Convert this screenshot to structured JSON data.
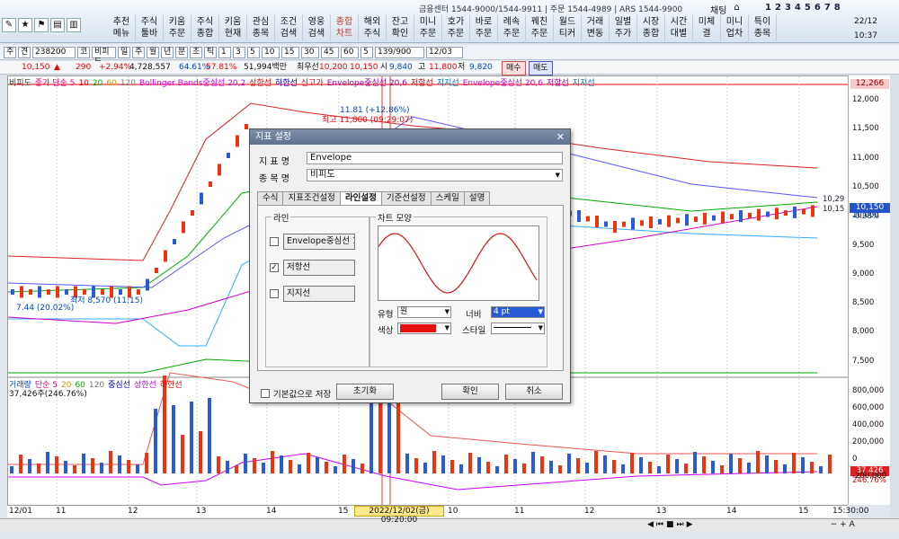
{
  "menubar": {
    "info": "금융센터 1544-9000/1544-9911 | 주문 1544-4989 | ARS 1544-9900",
    "chat": "채팅",
    "num_tabs": [
      "1",
      "2",
      "3",
      "4",
      "5",
      "6",
      "7",
      "8"
    ],
    "clock_date": "22/12",
    "clock_time": "10:37",
    "items": [
      {
        "l1": "추천",
        "l2": "메뉴"
      },
      {
        "l1": "주식",
        "l2": "툴바"
      },
      {
        "l1": "키움",
        "l2": "주문"
      },
      {
        "l1": "주식",
        "l2": "종합"
      },
      {
        "l1": "키움",
        "l2": "현재"
      },
      {
        "l1": "관심",
        "l2": "종목"
      },
      {
        "l1": "조건",
        "l2": "검색"
      },
      {
        "l1": "영웅",
        "l2": "검색"
      },
      {
        "l1": "종합",
        "l2": "차트"
      },
      {
        "l1": "해외",
        "l2": "주식"
      },
      {
        "l1": "잔고",
        "l2": "확인"
      },
      {
        "l1": "미니",
        "l2": "주문"
      },
      {
        "l1": "호가",
        "l2": "주문"
      },
      {
        "l1": "바로",
        "l2": "주문"
      },
      {
        "l1": "례속",
        "l2": "주문"
      },
      {
        "l1": "꿰친",
        "l2": "주문"
      },
      {
        "l1": "월드",
        "l2": "티커"
      },
      {
        "l1": "거래",
        "l2": "변동"
      },
      {
        "l1": "일별",
        "l2": "주가"
      },
      {
        "l1": "시장",
        "l2": "종합"
      },
      {
        "l1": "시간",
        "l2": "대별"
      },
      {
        "l1": "미체",
        "l2": "결"
      },
      {
        "l1": "미니",
        "l2": "업차"
      },
      {
        "l1": "특이",
        "l2": "종목"
      }
    ]
  },
  "toolbar1": {
    "items": [
      "주",
      "견",
      "238200",
      "코",
      "비피도",
      "일",
      "주",
      "월",
      "년",
      "분",
      "초",
      "틱",
      "1",
      "3",
      "5",
      "10",
      "15",
      "30",
      "45",
      "60",
      "5",
      "139/900",
      "12/03"
    ]
  },
  "toolbar2": {
    "price": "10,150",
    "change": "290",
    "pct": "+2.94%",
    "volume": "4,728,557",
    "v1": "64.61%",
    "v2": "57.81%",
    "amount": "51,994백만",
    "label_best": "최우선",
    "best1": "10,200",
    "best2": "10,150",
    "open_l": "시",
    "open": "9,840",
    "high_l": "고",
    "high": "11,800",
    "low_l": "저",
    "low": "9,820",
    "buy": "매수",
    "sell": "매도"
  },
  "legend_top": [
    "비피도",
    "종가 단순 5",
    "10",
    "20",
    "60",
    "120",
    "Bollinger Bands중심선 20,2",
    "상한선",
    "하한선",
    "신고가",
    "Envelope중심선 20,6",
    "저항선",
    "지지선",
    "Envelope중심선 20,6",
    "저항선",
    "지지선"
  ],
  "legend_bottom": [
    "거래량",
    "단순 5",
    "20",
    "60",
    "120",
    "중심선",
    "상한선",
    "하한선"
  ],
  "chart_labels": {
    "hi_note": "11.81 (+12.86%)",
    "hi_label": "최고 11,800 (09:29:07)",
    "lo_label": "최저 8,570 (11:15)",
    "pct_note": "7.44 (20.02%)",
    "vol_note": "37,426주(246.76%)",
    "tag1": "10,29",
    "tag2": "10,15",
    "tag3": "-0.98%",
    "cur_price": "10,150",
    "top_price": "12,266",
    "vol_tag": "37,426",
    "vol_pct": "246.76%"
  },
  "y_axis_labels": [
    "12,000",
    "11,500",
    "11,000",
    "10,500",
    "10,000",
    "9,500",
    "9,000",
    "8,500",
    "8,000",
    "7,500"
  ],
  "vol_axis_labels": [
    "800,000",
    "600,000",
    "400,000",
    "200,000",
    "0",
    "-200,000"
  ],
  "x_axis_labels": [
    "12/01",
    "11",
    "12",
    "13",
    "14",
    "15",
    "2022/12/02(금) 09:20:00",
    "10",
    "11",
    "12",
    "13",
    "14",
    "15",
    "15:30:00"
  ],
  "dialog": {
    "title": "지표 설정",
    "name_label": "지 표 명",
    "name_value": "Envelope",
    "stock_label": "종 목 명",
    "stock_value": "비피도",
    "tabs": [
      "수식",
      "지표조건설정",
      "라인설정",
      "기준선설정",
      "스케일",
      "설명"
    ],
    "line_group": "라인",
    "style_group": "차트 모양",
    "lines": [
      {
        "label": "Envelope중심선 10",
        "checked": ""
      },
      {
        "label": "저항선",
        "checked": "✓"
      },
      {
        "label": "지지선",
        "checked": ""
      }
    ],
    "type_label": "유형",
    "type_value": "원",
    "width_label": "너비",
    "width_value": "4 pt",
    "color_label": "색상",
    "color_value": "#e41010",
    "style_label": "스타일",
    "save_default": "기본값으로 저장",
    "reset": "초기화",
    "ok": "확인",
    "cancel": "취소"
  }
}
